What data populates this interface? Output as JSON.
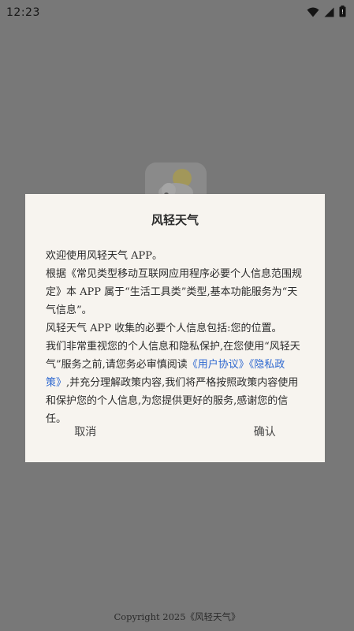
{
  "status_bar": {
    "time": "12:23",
    "icons": [
      "wifi-icon",
      "cellular-signal-icon",
      "battery-icon"
    ]
  },
  "background": {
    "logo_icon": "weather-app-logo-icon",
    "copyright": "Copyright 2025《风轻天气》"
  },
  "dialog": {
    "title": "风轻天气",
    "paragraphs": {
      "p1": "欢迎使用风轻天气 APP。",
      "p2": "根据《常见类型移动互联网应用程序必要个人信息范围规定》本 APP 属于“生活工具类”类型,基本功能服务为“天气信息”。",
      "p3": "风轻天气 APP 收集的必要个人信息包括:您的位置。",
      "p4_before": "我们非常重视您的个人信息和隐私保护,在您使用“风轻天气”服务之前,请您务必审慎阅读",
      "user_agreement_link": "《用户协议》",
      "privacy_policy_link": "《隐私政策》",
      "p4_after": ",并充分理解政策内容,我们将严格按照政策内容使用和保护您的个人信息,为您提供更好的服务,感谢您的信任。"
    },
    "cancel_label": "取消",
    "confirm_label": "确认"
  },
  "colors": {
    "overlay": "#787878",
    "dialog_bg": "#f7f4ef",
    "link": "#2e68d0",
    "text": "#2b2b2b"
  }
}
